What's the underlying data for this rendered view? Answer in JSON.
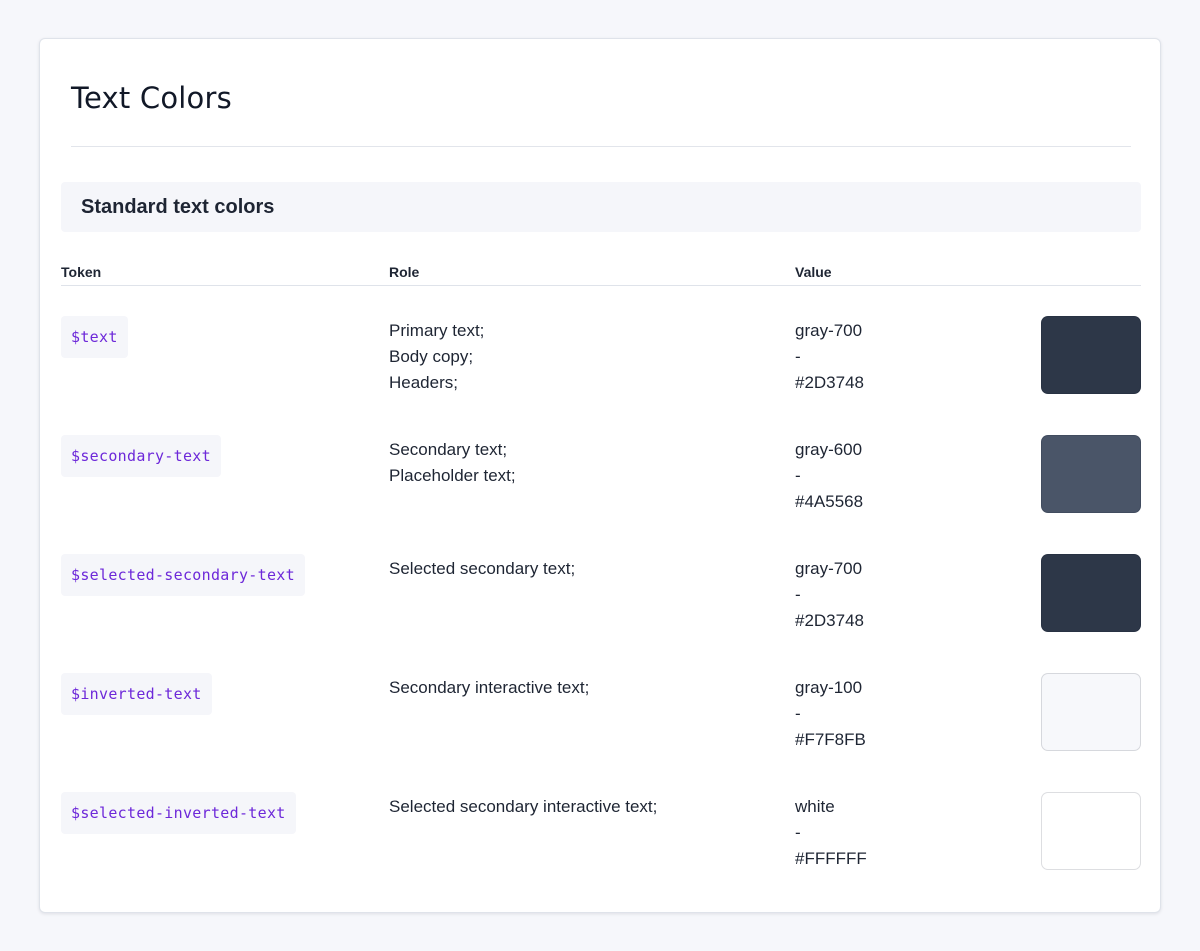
{
  "page": {
    "title": "Text Colors"
  },
  "section": {
    "title": "Standard text colors"
  },
  "table": {
    "headers": {
      "token": "Token",
      "role": "Role",
      "value": "Value"
    },
    "rows": [
      {
        "token": "$text",
        "roles": [
          "Primary text;",
          "Body copy;",
          "Headers;"
        ],
        "value_name": "gray-700",
        "value_sep": "-",
        "value_hex": "#2D3748",
        "swatch_color": "#2D3748"
      },
      {
        "token": "$secondary-text",
        "roles": [
          "Secondary text;",
          "Placeholder text;"
        ],
        "value_name": "gray-600",
        "value_sep": "-",
        "value_hex": "#4A5568",
        "swatch_color": "#4A5568"
      },
      {
        "token": "$selected-secondary-text",
        "roles": [
          "Selected secondary text;"
        ],
        "value_name": "gray-700",
        "value_sep": "-",
        "value_hex": "#2D3748",
        "swatch_color": "#2D3748"
      },
      {
        "token": "$inverted-text",
        "roles": [
          "Secondary interactive text;"
        ],
        "value_name": "gray-100",
        "value_sep": "-",
        "value_hex": "#F7F8FB",
        "swatch_color": "#F7F8FB"
      },
      {
        "token": "$selected-inverted-text",
        "roles": [
          "Selected secondary interactive text;"
        ],
        "value_name": "white",
        "value_sep": "-",
        "value_hex": "#FFFFFF",
        "swatch_color": "#FFFFFF"
      }
    ]
  },
  "colors": {
    "token_text": "#6D28D9",
    "chip_bg": "#F5F6FA",
    "page_bg": "#F6F7FB"
  }
}
